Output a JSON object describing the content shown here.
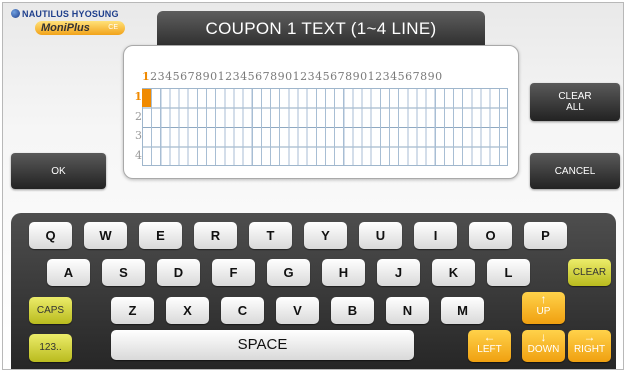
{
  "logo": {
    "brand": "NAUTILUS HYOSUNG",
    "product": "MoniPlus",
    "suffix": "CE"
  },
  "title": "COUPON 1 TEXT (1~4 LINE)",
  "editor": {
    "ruler_first": "1",
    "ruler_rest": "234567890123456789012345678901234567890",
    "rows": [
      "1",
      "2",
      "3",
      "4"
    ],
    "columns": 40,
    "cursor": {
      "row": 1,
      "col": 1
    }
  },
  "buttons": {
    "ok": "OK",
    "clear_all_1": "CLEAR",
    "clear_all_2": "ALL",
    "cancel": "CANCEL"
  },
  "keyboard": {
    "row1": [
      "Q",
      "W",
      "E",
      "R",
      "T",
      "Y",
      "U",
      "I",
      "O",
      "P"
    ],
    "row2": [
      "A",
      "S",
      "D",
      "F",
      "G",
      "H",
      "J",
      "K",
      "L"
    ],
    "row3": [
      "Z",
      "X",
      "C",
      "V",
      "B",
      "N",
      "M"
    ],
    "clear": "CLEAR",
    "caps": "CAPS",
    "num": "123..",
    "space": "SPACE",
    "up": "UP",
    "left": "LEFT",
    "down": "DOWN",
    "right": "RIGHT"
  },
  "colors": {
    "accent": "#f08a00",
    "function_key": "#c8ca2a",
    "arrow_key": "#f5b020"
  }
}
